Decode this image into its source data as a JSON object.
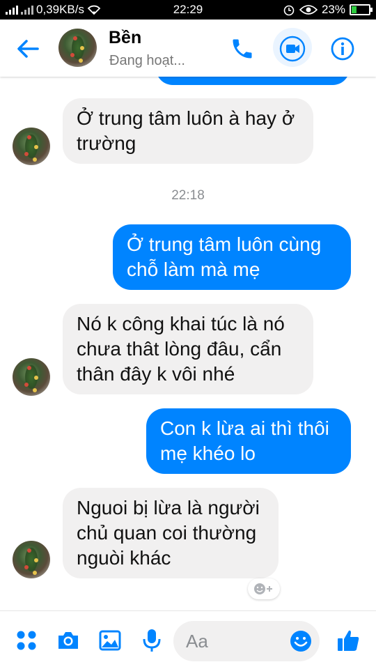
{
  "status_bar": {
    "network_speed": "0,39KB/s",
    "time": "22:29",
    "battery": "23%"
  },
  "header": {
    "contact_name": "Bền",
    "contact_status": "Đang hoạt..."
  },
  "messages": [
    {
      "direction": "in",
      "text": "Ở trung tâm luôn à hay ở trường"
    },
    {
      "direction": "out",
      "text": "Ở trung tâm luôn cùng chỗ làm mà mẹ"
    },
    {
      "direction": "in",
      "text": "Nó k công khai túc là nó chưa thât lòng đâu, cẩn thân đây k vôi nhé"
    },
    {
      "direction": "out",
      "text": "Con k lừa ai thì thôi mẹ khéo lo"
    },
    {
      "direction": "in",
      "text": "Nguoi bị lừa là người chủ quan coi thường nguòi khác"
    }
  ],
  "timestamp": "22:18",
  "composer": {
    "placeholder": "Aa"
  },
  "colors": {
    "accent": "#0084ff",
    "incoming_bubble": "#f1f0f0"
  },
  "icons": [
    "back-arrow-icon",
    "phone-icon",
    "video-camera-icon",
    "info-icon",
    "apps-grid-icon",
    "camera-icon",
    "gallery-icon",
    "microphone-icon",
    "emoji-icon",
    "thumbs-up-icon",
    "add-reaction-icon"
  ]
}
